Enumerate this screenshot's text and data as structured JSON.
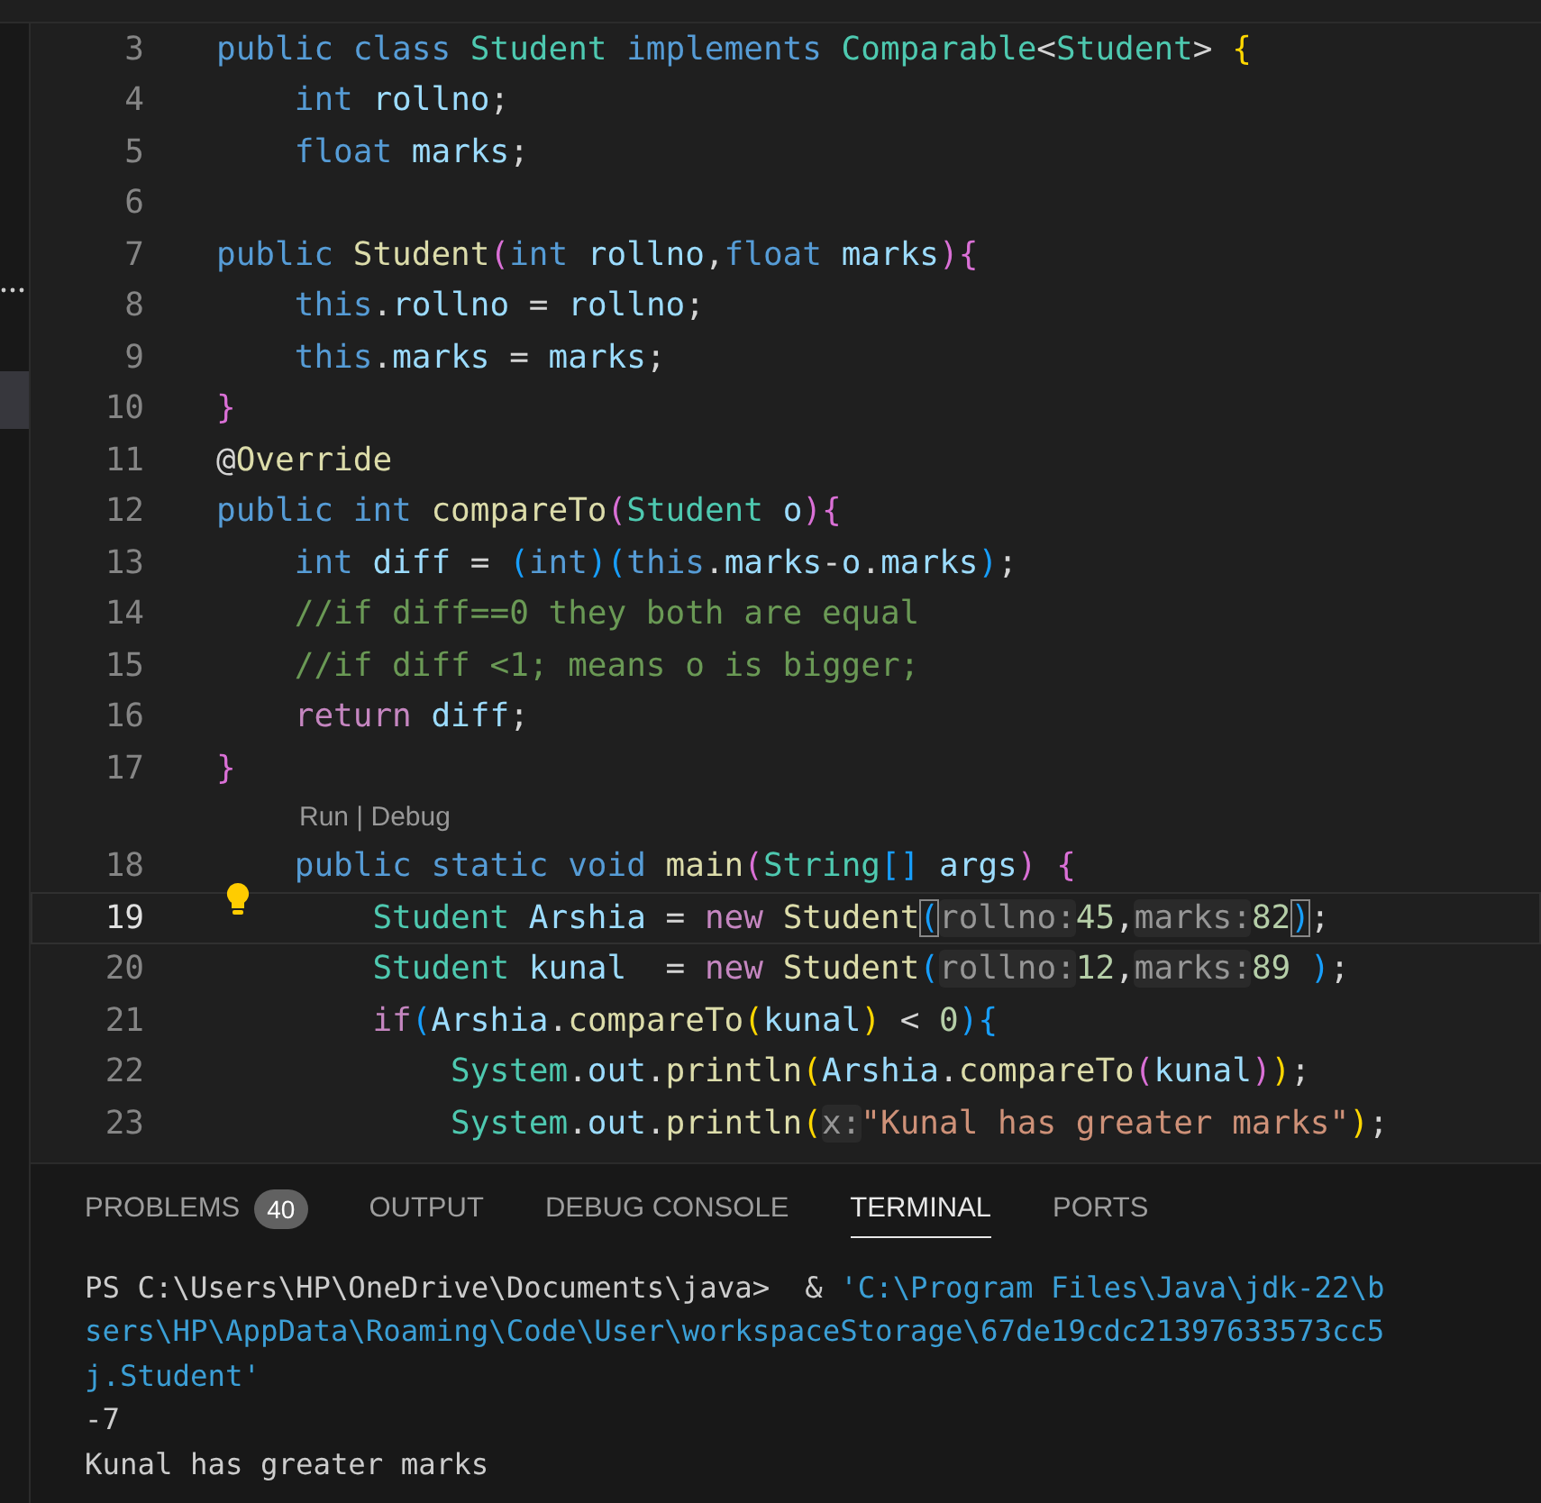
{
  "editor": {
    "lines": [
      {
        "no": "3",
        "current": false,
        "lightbulb": false,
        "tokens": [
          {
            "text": "public class ",
            "kind": "kw"
          },
          {
            "text": "Student",
            "kind": "type"
          },
          {
            "text": " implements ",
            "kind": "kw"
          },
          {
            "text": "Comparable",
            "kind": "type"
          },
          {
            "text": "<",
            "kind": "plain"
          },
          {
            "text": "Student",
            "kind": "type"
          },
          {
            "text": "> ",
            "kind": "plain"
          },
          {
            "text": "{",
            "kind": "b1"
          }
        ]
      },
      {
        "no": "4",
        "current": false,
        "lightbulb": false,
        "tokens": [
          {
            "text": "    int ",
            "kind": "kw"
          },
          {
            "text": "rollno",
            "kind": "var"
          },
          {
            "text": ";",
            "kind": "plain"
          }
        ]
      },
      {
        "no": "5",
        "current": false,
        "lightbulb": false,
        "tokens": [
          {
            "text": "    float ",
            "kind": "kw"
          },
          {
            "text": "marks",
            "kind": "var"
          },
          {
            "text": ";",
            "kind": "plain"
          }
        ]
      },
      {
        "no": "6",
        "current": false,
        "lightbulb": false
      },
      {
        "no": "7",
        "current": false,
        "lightbulb": false,
        "tokens": [
          {
            "text": "public ",
            "kind": "kw"
          },
          {
            "text": "Student",
            "kind": "fn"
          },
          {
            "text": "(",
            "kind": "b2"
          },
          {
            "text": "int ",
            "kind": "kw"
          },
          {
            "text": "rollno",
            "kind": "var"
          },
          {
            "text": ",",
            "kind": "plain"
          },
          {
            "text": "float ",
            "kind": "kw"
          },
          {
            "text": "marks",
            "kind": "var"
          },
          {
            "text": ")",
            "kind": "b2"
          },
          {
            "text": "{",
            "kind": "b2"
          }
        ]
      },
      {
        "no": "8",
        "current": false,
        "lightbulb": false,
        "tokens": [
          {
            "text": "    this",
            "kind": "kw"
          },
          {
            "text": ".",
            "kind": "plain"
          },
          {
            "text": "rollno",
            "kind": "var"
          },
          {
            "text": " = ",
            "kind": "plain"
          },
          {
            "text": "rollno",
            "kind": "var"
          },
          {
            "text": ";",
            "kind": "plain"
          }
        ]
      },
      {
        "no": "9",
        "current": false,
        "lightbulb": false,
        "tokens": [
          {
            "text": "    this",
            "kind": "kw"
          },
          {
            "text": ".",
            "kind": "plain"
          },
          {
            "text": "marks",
            "kind": "var"
          },
          {
            "text": " = ",
            "kind": "plain"
          },
          {
            "text": "marks",
            "kind": "var"
          },
          {
            "text": ";",
            "kind": "plain"
          }
        ]
      },
      {
        "no": "10",
        "current": false,
        "lightbulb": false,
        "tokens": [
          {
            "text": "}",
            "kind": "b2"
          }
        ]
      },
      {
        "no": "11",
        "current": false,
        "lightbulb": false,
        "tokens": [
          {
            "text": "@",
            "kind": "plain"
          },
          {
            "text": "Override",
            "kind": "fn"
          }
        ]
      },
      {
        "no": "12",
        "current": false,
        "lightbulb": false,
        "tokens": [
          {
            "text": "public int ",
            "kind": "kw"
          },
          {
            "text": "compareTo",
            "kind": "fn"
          },
          {
            "text": "(",
            "kind": "b2"
          },
          {
            "text": "Student ",
            "kind": "type"
          },
          {
            "text": "o",
            "kind": "var"
          },
          {
            "text": ")",
            "kind": "b2"
          },
          {
            "text": "{",
            "kind": "b2"
          }
        ]
      },
      {
        "no": "13",
        "current": false,
        "lightbulb": false,
        "tokens": [
          {
            "text": "    int ",
            "kind": "kw"
          },
          {
            "text": "diff",
            "kind": "var"
          },
          {
            "text": " = ",
            "kind": "plain"
          },
          {
            "text": "(",
            "kind": "b3"
          },
          {
            "text": "int",
            "kind": "kw"
          },
          {
            "text": ")",
            "kind": "b3"
          },
          {
            "text": "(",
            "kind": "b3"
          },
          {
            "text": "this",
            "kind": "kw"
          },
          {
            "text": ".",
            "kind": "plain"
          },
          {
            "text": "marks",
            "kind": "var"
          },
          {
            "text": "-",
            "kind": "plain"
          },
          {
            "text": "o",
            "kind": "var"
          },
          {
            "text": ".",
            "kind": "plain"
          },
          {
            "text": "marks",
            "kind": "var"
          },
          {
            "text": ")",
            "kind": "b3"
          },
          {
            "text": ";",
            "kind": "plain"
          }
        ]
      },
      {
        "no": "14",
        "current": false,
        "lightbulb": false,
        "tokens": [
          {
            "text": "    //if diff==0 they both are equal",
            "kind": "cmt"
          }
        ]
      },
      {
        "no": "15",
        "current": false,
        "lightbulb": false,
        "tokens": [
          {
            "text": "    //if diff <1; means o is bigger;",
            "kind": "cmt"
          }
        ]
      },
      {
        "no": "16",
        "current": false,
        "lightbulb": false,
        "tokens": [
          {
            "text": "    return ",
            "kind": "ctrl"
          },
          {
            "text": "diff",
            "kind": "var"
          },
          {
            "text": ";",
            "kind": "plain"
          }
        ]
      },
      {
        "no": "17",
        "current": false,
        "lightbulb": false,
        "codelens": "Run | Debug",
        "tokens": [
          {
            "text": "}",
            "kind": "b2"
          }
        ]
      },
      {
        "no": "18",
        "current": false,
        "lightbulb": false,
        "tokens": [
          {
            "text": "    public static void ",
            "kind": "kw"
          },
          {
            "text": "main",
            "kind": "fn"
          },
          {
            "text": "(",
            "kind": "b2"
          },
          {
            "text": "String",
            "kind": "type"
          },
          {
            "text": "[]",
            "kind": "b3"
          },
          {
            "text": " args",
            "kind": "var"
          },
          {
            "text": ") ",
            "kind": "b2"
          },
          {
            "text": "{",
            "kind": "b2"
          }
        ]
      },
      {
        "no": "19",
        "current": true,
        "lightbulb": true,
        "tokens": [
          {
            "text": "        Student ",
            "kind": "type"
          },
          {
            "text": "Arshia",
            "kind": "var"
          },
          {
            "text": " = ",
            "kind": "plain"
          },
          {
            "text": "new ",
            "kind": "ctrl"
          },
          {
            "text": "Student",
            "kind": "fn"
          },
          {
            "text": "(",
            "kind": "b3match"
          },
          {
            "text": "rollno:",
            "kind": "hint"
          },
          {
            "text": "45",
            "kind": "num"
          },
          {
            "text": ",",
            "kind": "plain"
          },
          {
            "text": "marks:",
            "kind": "hint"
          },
          {
            "text": "82",
            "kind": "num"
          },
          {
            "text": ")",
            "kind": "b3match"
          },
          {
            "text": ";",
            "kind": "plain"
          }
        ]
      },
      {
        "no": "20",
        "current": false,
        "lightbulb": false,
        "tokens": [
          {
            "text": "        Student ",
            "kind": "type"
          },
          {
            "text": "kunal",
            "kind": "var"
          },
          {
            "text": "  = ",
            "kind": "plain"
          },
          {
            "text": "new ",
            "kind": "ctrl"
          },
          {
            "text": "Student",
            "kind": "fn"
          },
          {
            "text": "(",
            "kind": "b3"
          },
          {
            "text": "rollno:",
            "kind": "hint"
          },
          {
            "text": "12",
            "kind": "num"
          },
          {
            "text": ",",
            "kind": "plain"
          },
          {
            "text": "marks:",
            "kind": "hint"
          },
          {
            "text": "89",
            "kind": "num"
          },
          {
            "text": " )",
            "kind": "b3"
          },
          {
            "text": ";",
            "kind": "plain"
          }
        ]
      },
      {
        "no": "21",
        "current": false,
        "lightbulb": false,
        "tokens": [
          {
            "text": "        if",
            "kind": "ctrl"
          },
          {
            "text": "(",
            "kind": "b3"
          },
          {
            "text": "Arshia",
            "kind": "var"
          },
          {
            "text": ".",
            "kind": "plain"
          },
          {
            "text": "compareTo",
            "kind": "fn"
          },
          {
            "text": "(",
            "kind": "b1"
          },
          {
            "text": "kunal",
            "kind": "var"
          },
          {
            "text": ")",
            "kind": "b1"
          },
          {
            "text": " < ",
            "kind": "plain"
          },
          {
            "text": "0",
            "kind": "num"
          },
          {
            "text": ")",
            "kind": "b3"
          },
          {
            "text": "{",
            "kind": "b3"
          }
        ]
      },
      {
        "no": "22",
        "current": false,
        "lightbulb": false,
        "tokens": [
          {
            "text": "            System",
            "kind": "type"
          },
          {
            "text": ".",
            "kind": "plain"
          },
          {
            "text": "out",
            "kind": "var"
          },
          {
            "text": ".",
            "kind": "plain"
          },
          {
            "text": "println",
            "kind": "fn"
          },
          {
            "text": "(",
            "kind": "b1"
          },
          {
            "text": "Arshia",
            "kind": "var"
          },
          {
            "text": ".",
            "kind": "plain"
          },
          {
            "text": "compareTo",
            "kind": "fn"
          },
          {
            "text": "(",
            "kind": "b2"
          },
          {
            "text": "kunal",
            "kind": "var"
          },
          {
            "text": ")",
            "kind": "b2"
          },
          {
            "text": ")",
            "kind": "b1"
          },
          {
            "text": ";",
            "kind": "plain"
          }
        ]
      },
      {
        "no": "23",
        "current": false,
        "lightbulb": false,
        "tokens": [
          {
            "text": "            System",
            "kind": "type"
          },
          {
            "text": ".",
            "kind": "plain"
          },
          {
            "text": "out",
            "kind": "var"
          },
          {
            "text": ".",
            "kind": "plain"
          },
          {
            "text": "println",
            "kind": "fn"
          },
          {
            "text": "(",
            "kind": "b1"
          },
          {
            "text": "x:",
            "kind": "hint"
          },
          {
            "text": "\"Kunal has greater marks\"",
            "kind": "str"
          },
          {
            "text": ")",
            "kind": "b1"
          },
          {
            "text": ";",
            "kind": "plain"
          }
        ]
      }
    ]
  },
  "panel": {
    "tabs": [
      {
        "label": "PROBLEMS",
        "badge": "40",
        "selected": false
      },
      {
        "label": "OUTPUT",
        "selected": false
      },
      {
        "label": "DEBUG CONSOLE",
        "selected": false
      },
      {
        "label": "TERMINAL",
        "selected": true
      },
      {
        "label": "PORTS",
        "selected": false
      }
    ],
    "terminal": [
      [
        {
          "text": "PS C:\\Users\\HP\\OneDrive\\Documents\\java>  & ",
          "kind": "plain"
        },
        {
          "text": "'C:\\Program Files\\Java\\jdk-22\\b",
          "kind": "path"
        }
      ],
      [
        {
          "text": "sers\\HP\\AppData\\Roaming\\Code\\User\\workspaceStorage\\67de19cdc21397633573cc5",
          "kind": "path"
        }
      ],
      [
        {
          "text": "j.Student'",
          "kind": "path"
        }
      ],
      [
        {
          "text": "-7",
          "kind": "plain"
        }
      ],
      [
        {
          "text": "Kunal has greater marks",
          "kind": "plain"
        }
      ]
    ]
  }
}
